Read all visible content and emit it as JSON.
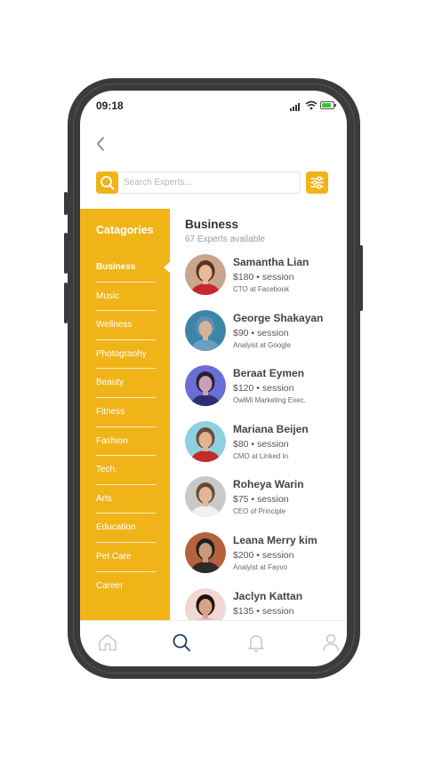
{
  "status_bar": {
    "time": "09:18"
  },
  "search": {
    "placeholder": "Search Experts..."
  },
  "categories": {
    "title": "Catagories",
    "items": [
      {
        "label": "Business",
        "active": true
      },
      {
        "label": "Music"
      },
      {
        "label": "Wellness"
      },
      {
        "label": "Photograohy"
      },
      {
        "label": "Beauty"
      },
      {
        "label": "Fitness"
      },
      {
        "label": "Fashion"
      },
      {
        "label": "Tech."
      },
      {
        "label": "Arts"
      },
      {
        "label": "Education"
      },
      {
        "label": "Pet Care"
      },
      {
        "label": "Career"
      }
    ]
  },
  "experts": {
    "heading": "Business",
    "count_text": "67 Experts available",
    "items": [
      {
        "name": "Samantha Lian",
        "price": "$180 • session",
        "role": "CTO at Facebook",
        "avatar_bg": "#c9a58c",
        "shirt": "#c8262f",
        "hair": "#5a3222",
        "skin": "#e8b899"
      },
      {
        "name": "George Shakayan",
        "price": "$90 • session",
        "role": "Analyist at Google",
        "avatar_bg": "#3b86a8",
        "shirt": "#6a9ec1",
        "hair": "#5d8fb3",
        "skin": "#d5b39a"
      },
      {
        "name": "Beraat Eymen",
        "price": "$120 • session",
        "role": "OwlMi Marketing Exec.",
        "avatar_bg": "#6a6fd6",
        "shirt": "#2c2f70",
        "hair": "#2a2030",
        "skin": "#c9a0b8"
      },
      {
        "name": "Mariana Beijen",
        "price": "$80 • session",
        "role": "CMO at Linked In",
        "avatar_bg": "#8fd0e0",
        "shirt": "#c42a2a",
        "hair": "#6a4a38",
        "skin": "#e3b28f"
      },
      {
        "name": "Roheya Warin",
        "price": "$75 • session",
        "role": "CEO of Principle",
        "avatar_bg": "#c9c9c9",
        "shirt": "#f1f1f1",
        "hair": "#6b4a2a",
        "skin": "#e2b797"
      },
      {
        "name": "Leana Merry kim",
        "price": "$200 • session",
        "role": "Analyist at Fayvo",
        "avatar_bg": "#b5623d",
        "shirt": "#2b2b2b",
        "hair": "#1f1f1f",
        "skin": "#c99a7a"
      },
      {
        "name": "Jaclyn Kattan",
        "price": "$135 • session",
        "role": "",
        "avatar_bg": "#f1d7d4",
        "shirt": "#e3c2bc",
        "hair": "#1b1410",
        "skin": "#d9a285"
      }
    ]
  },
  "nav": {
    "items": [
      {
        "icon": "home-icon",
        "active": false
      },
      {
        "icon": "search-icon",
        "active": true
      },
      {
        "icon": "bell-icon",
        "active": false
      },
      {
        "icon": "user-icon",
        "active": false
      }
    ]
  },
  "colors": {
    "accent": "#f0b419",
    "nav_active": "#1f3e66",
    "nav_inactive": "#c9c9c9"
  }
}
